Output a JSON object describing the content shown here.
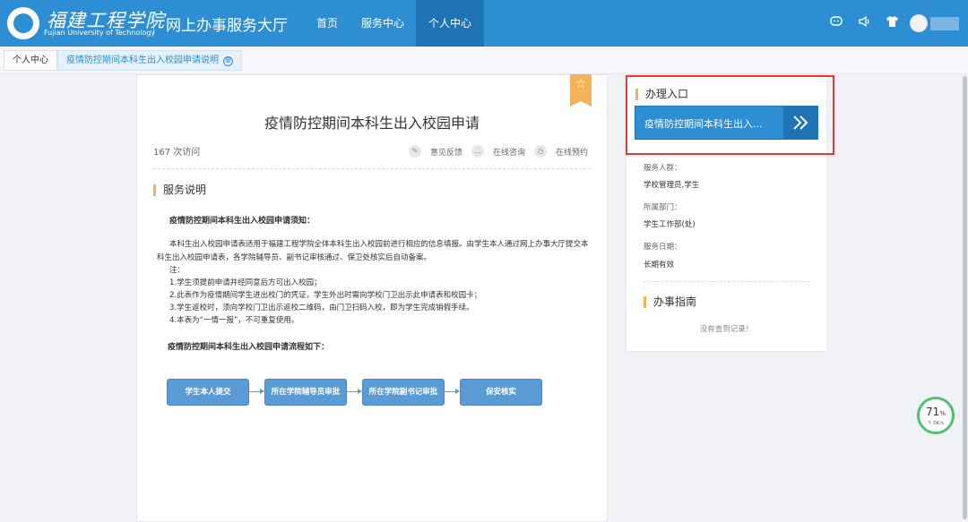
{
  "header": {
    "logo_cn": "福建工程学院",
    "logo_en": "Fujian University of Technology",
    "system_title": "网上办事服务大厅",
    "nav": [
      "首页",
      "服务中心",
      "个人中心"
    ],
    "active_nav": "个人中心",
    "icons": [
      "chat-icon",
      "speaker-icon",
      "tshirt-icon"
    ]
  },
  "tabs": [
    {
      "label": "个人中心"
    },
    {
      "label": "疫情防控期间本科生出入校园申请说明",
      "close_icon": "⊗"
    }
  ],
  "main": {
    "star_icon": "☆",
    "title": "疫情防控期间本科生出入校园申请",
    "visits": "167 次访问",
    "actions": [
      {
        "icon": "edit-icon",
        "glyph": "✎",
        "label": "意见反馈"
      },
      {
        "icon": "chat-icon",
        "glyph": "…",
        "label": "在线咨询"
      },
      {
        "icon": "clock-icon",
        "glyph": "◷",
        "label": "在线预约"
      }
    ],
    "section_title": "服务说明",
    "notice_head": "疫情防控期间本科生出入校园申请须知：",
    "paragraph": "本科生出入校园申请表适用于福建工程学院全体本科生出入校园前进行相应的信息填报。由学生本人通过网上办事大厅提交本科生出入校园申请表，各学院辅导员、副书记审核通过、保卫处核实后自动备案。",
    "notes": [
      "注：",
      "1.学生须提前申请并经同意后方可出入校园；",
      "2.此表作为疫情期间学生进出校门的凭证，学生外出时需向学校门卫出示此申请表和校园卡；",
      "3.学生返校时，须向学校门卫出示返校二维码，由门卫扫码入校，即为学生完成销假手续。",
      "4.本表为“一情一报”，不可重复使用。"
    ],
    "flow_head": "疫情防控期间本科生出入校园申请流程如下：",
    "flow_steps": [
      "学生本人提交",
      "所在学院辅导员审批",
      "所在学院副书记审批",
      "保安核实"
    ]
  },
  "side": {
    "entry_title": "办理入口",
    "entry_button": "疫情防控期间本科生出入...",
    "entry_arrow": "»",
    "info": [
      {
        "label": "服务人群：",
        "value": "学校管理员,学生"
      },
      {
        "label": "所属部门：",
        "value": "学生工作部(处)"
      },
      {
        "label": "服务日期：",
        "value": "长期有效"
      }
    ],
    "guide_title": "办事指南",
    "no_record": "没有查到记录！"
  },
  "speed_widget": {
    "percent": "71",
    "percent_unit": "%",
    "rate": "↑ 0K/s"
  },
  "colors": {
    "header_blue": "#2d8ed3",
    "active_nav": "#1f74b6",
    "accent_orange": "#f4b35a",
    "highlight_red": "#e53935",
    "flow_blue": "#5b9bd5"
  }
}
